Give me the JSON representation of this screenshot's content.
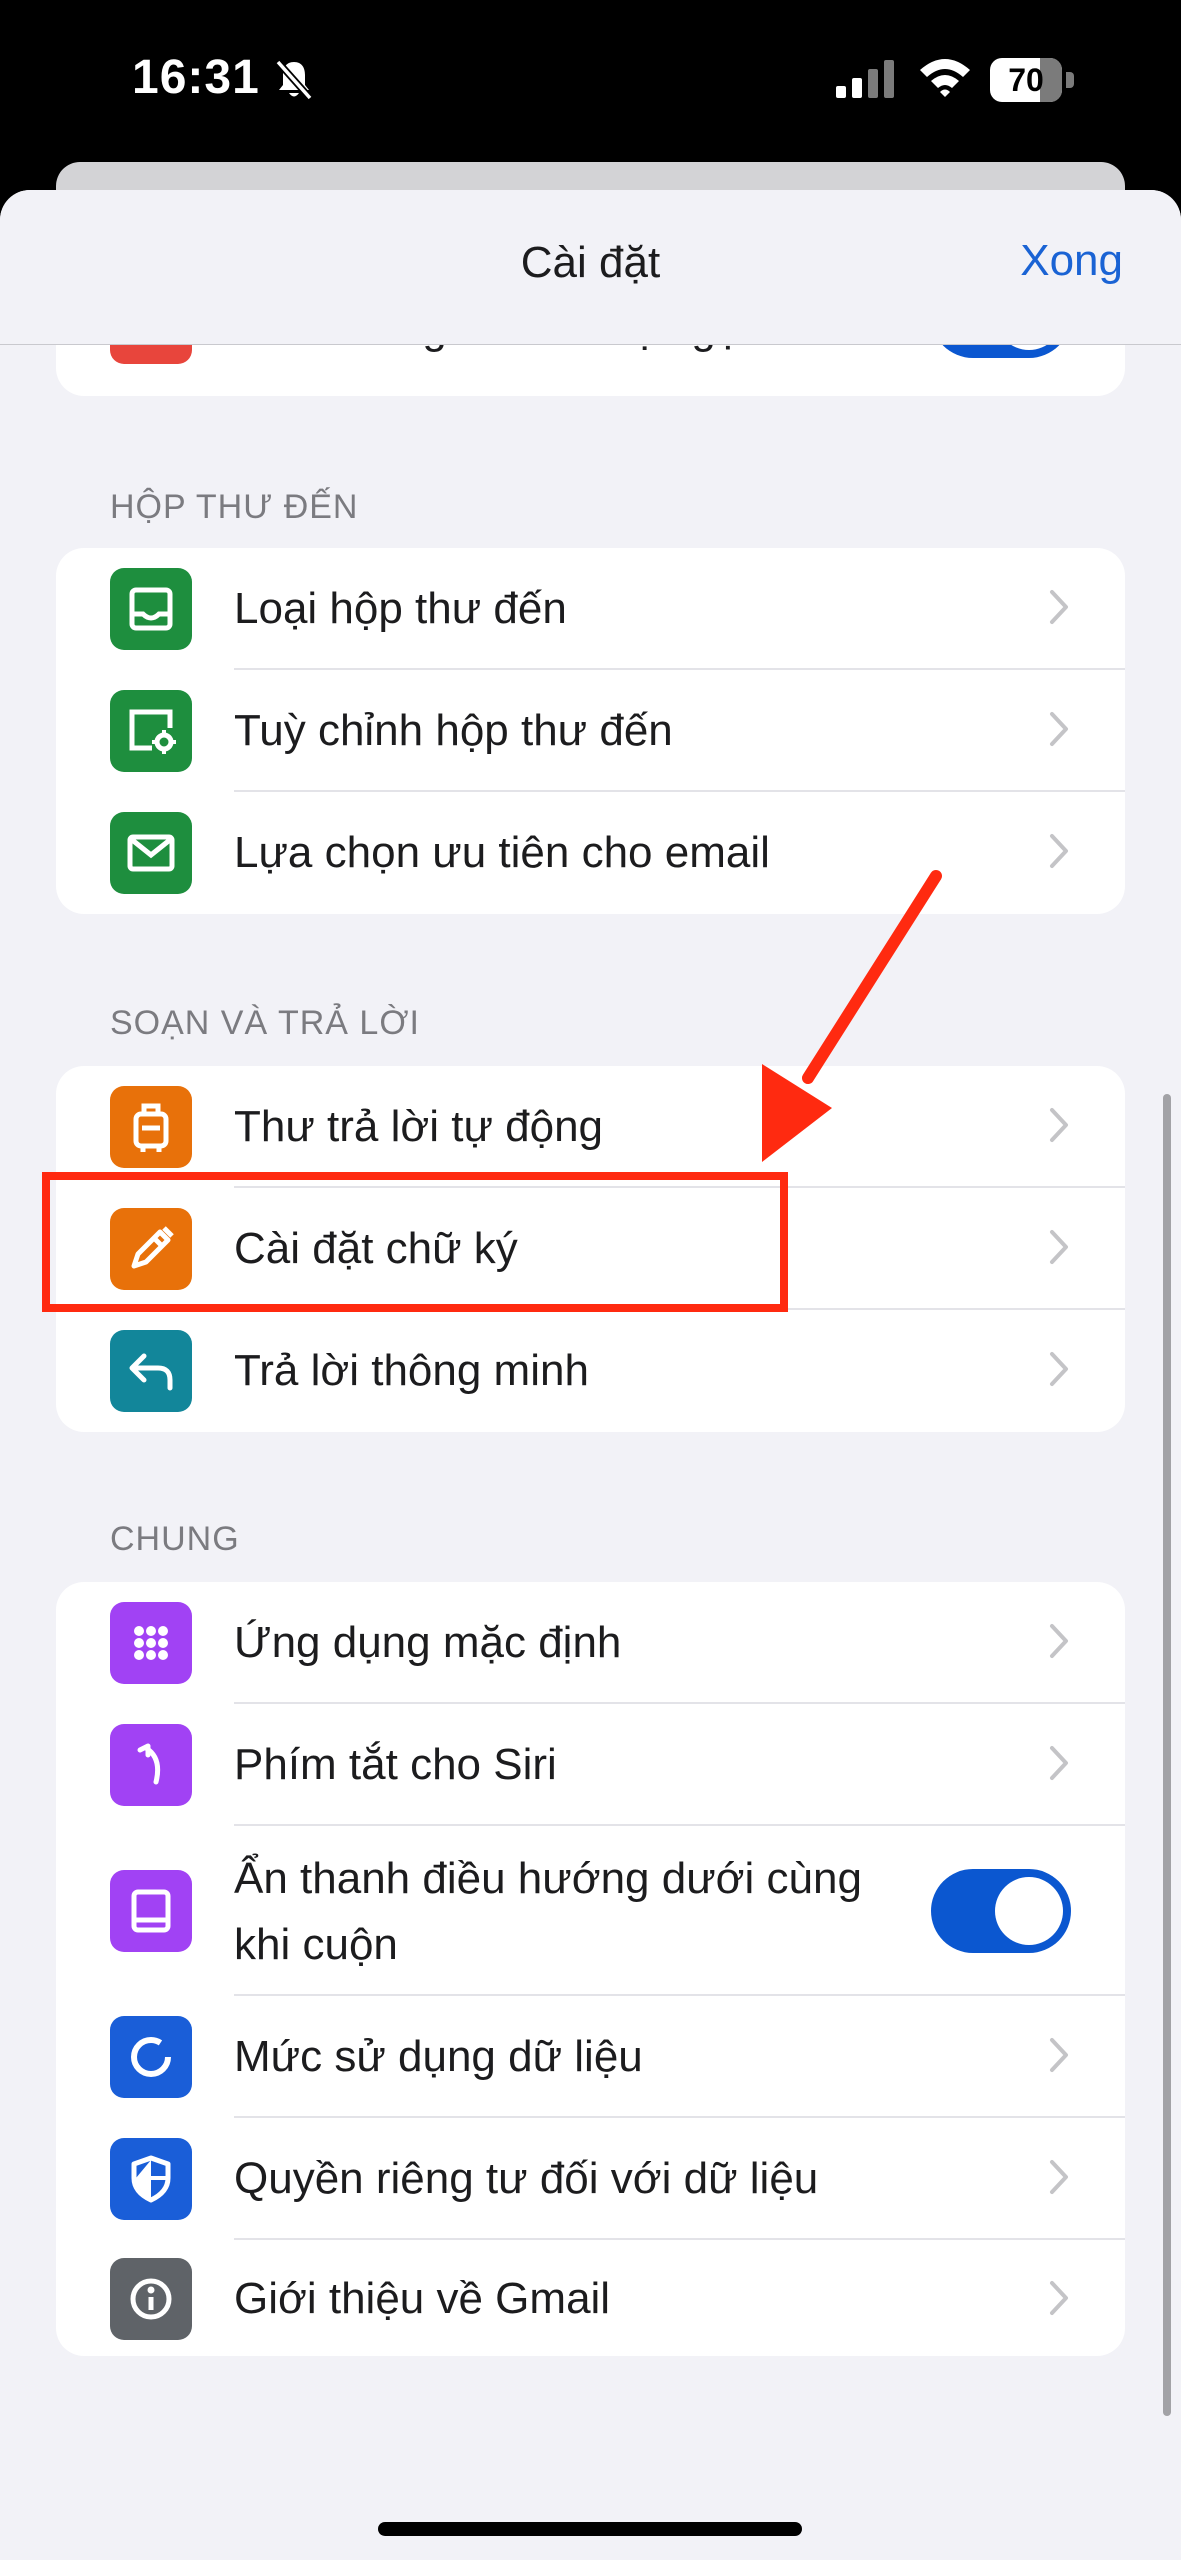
{
  "status_bar": {
    "time": "16:31",
    "battery": "70"
  },
  "nav": {
    "title": "Cài đặt",
    "done": "Xong"
  },
  "partial_row": {
    "label": "Đổ chuông khi có cuộc gọi đến",
    "toggle_on": true
  },
  "sections": [
    {
      "header": "HỘP THƯ ĐẾN",
      "items": [
        {
          "label": "Loại hộp thư đến",
          "icon": "inbox-icon",
          "color": "#1e8e3e"
        },
        {
          "label": "Tuỳ chỉnh hộp thư đến",
          "icon": "inbox-settings-icon",
          "color": "#1e8e3e"
        },
        {
          "label": "Lựa chọn ưu tiên cho email",
          "icon": "mail-icon",
          "color": "#1e8e3e"
        }
      ]
    },
    {
      "header": "SOẠN VÀ TRẢ LỜI",
      "items": [
        {
          "label": "Thư trả lời tự động",
          "icon": "luggage-icon",
          "color": "#e8710a"
        },
        {
          "label": "Cài đặt chữ ký",
          "icon": "signature-pen-icon",
          "color": "#e8710a"
        },
        {
          "label": "Trả lời thông minh",
          "icon": "reply-icon",
          "color": "#12869a"
        }
      ]
    },
    {
      "header": "CHUNG",
      "items": [
        {
          "label": "Ứng dụng mặc định",
          "icon": "apps-grid-icon",
          "color": "#a142f4"
        },
        {
          "label": "Phím tắt cho Siri",
          "icon": "siri-shortcut-icon",
          "color": "#a142f4"
        },
        {
          "label_line1": "Ẩn thanh điều hướng dưới cùng",
          "label_line2": "khi cuộn",
          "icon": "bottom-bar-icon",
          "color": "#a142f4",
          "toggle_on": true
        },
        {
          "label": "Mức sử dụng dữ liệu",
          "icon": "data-usage-icon",
          "color": "#1a5ed8"
        },
        {
          "label": "Quyền riêng tư đối với dữ liệu",
          "icon": "privacy-shield-icon",
          "color": "#1a5ed8"
        },
        {
          "label": "Giới thiệu về Gmail",
          "icon": "info-icon",
          "color": "#5f6368"
        }
      ]
    }
  ],
  "accent_colors": {
    "link": "#1a63d4",
    "toggle": "#0b57d0",
    "annotation": "#ff2a10"
  }
}
